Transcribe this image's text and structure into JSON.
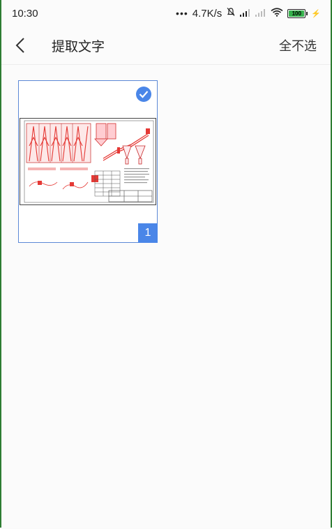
{
  "status_bar": {
    "time": "10:30",
    "network_speed": "4.7K/s",
    "battery_level": "100"
  },
  "header": {
    "title": "提取文字",
    "deselect_all_label": "全不选"
  },
  "pages": [
    {
      "page_number": "1",
      "selected": true
    }
  ],
  "colors": {
    "accent": "#4a86e8",
    "drawing_red": "#e53935",
    "battery_green": "#37b24d"
  }
}
